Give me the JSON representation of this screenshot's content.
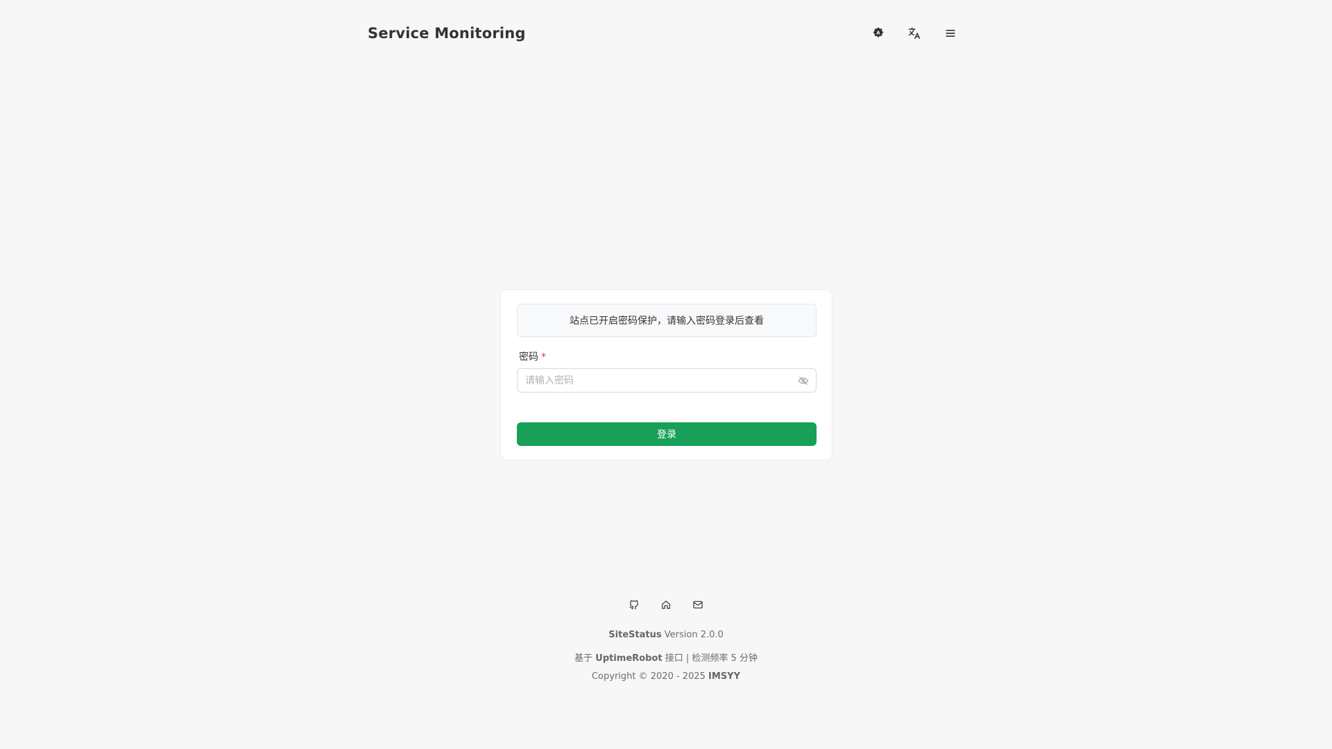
{
  "header": {
    "title": "Service Monitoring",
    "actions": [
      {
        "name": "theme-toggle",
        "icon": "theme-icon"
      },
      {
        "name": "language-switch",
        "icon": "translate-icon"
      },
      {
        "name": "menu",
        "icon": "menu-icon"
      }
    ]
  },
  "login": {
    "notice": "站点已开启密码保护，请输入密码登录后查看",
    "password_label": "密码",
    "required_mark": "*",
    "password_placeholder": "请输入密码",
    "password_value": "",
    "submit_label": "登录",
    "accent_color": "#18a058"
  },
  "footer": {
    "icons": [
      "github-icon",
      "home-icon",
      "mail-icon"
    ],
    "version": {
      "product": "SiteStatus",
      "text": "Version 2.0.0"
    },
    "powered": {
      "prefix": "基于",
      "provider": "UptimeRobot",
      "suffix": "接口 | 检测频率 5 分钟"
    },
    "copyright": {
      "text": "Copyright © 2020 - 2025",
      "owner": "IMSYY"
    }
  }
}
